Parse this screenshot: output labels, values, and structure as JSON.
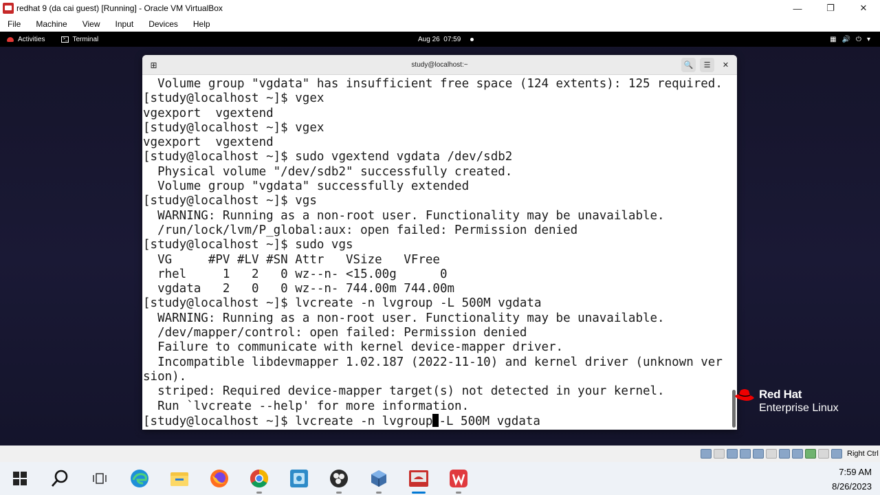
{
  "window": {
    "title": "redhat 9 (da cai guest) [Running] - Oracle VM VirtualBox",
    "controls": [
      "minimize-icon",
      "restore-icon",
      "close-icon"
    ]
  },
  "menubar": {
    "items": [
      "File",
      "Machine",
      "View",
      "Input",
      "Devices",
      "Help"
    ]
  },
  "gnome": {
    "activities": "Activities",
    "app": "Terminal",
    "clock": "Aug 26  07:59",
    "status_icons": [
      "network-icon",
      "volume-icon",
      "power-icon",
      "chevron-down-icon"
    ]
  },
  "terminal": {
    "title": "study@localhost:~",
    "header_buttons": [
      "search-icon",
      "hamburger-menu-icon",
      "close-icon"
    ],
    "lines": [
      "  Volume group \"vgdata\" has insufficient free space (124 extents): 125 required.",
      "[study@localhost ~]$ vgex",
      "vgexport  vgextend",
      "[study@localhost ~]$ vgex",
      "vgexport  vgextend",
      "[study@localhost ~]$ sudo vgextend vgdata /dev/sdb2",
      "  Physical volume \"/dev/sdb2\" successfully created.",
      "  Volume group \"vgdata\" successfully extended",
      "[study@localhost ~]$ vgs",
      "  WARNING: Running as a non-root user. Functionality may be unavailable.",
      "  /run/lock/lvm/P_global:aux: open failed: Permission denied",
      "[study@localhost ~]$ sudo vgs",
      "  VG     #PV #LV #SN Attr   VSize   VFree",
      "  rhel     1   2   0 wz--n- <15.00g      0",
      "  vgdata   2   0   0 wz--n- 744.00m 744.00m",
      "[study@localhost ~]$ lvcreate -n lvgroup -L 500M vgdata",
      "  WARNING: Running as a non-root user. Functionality may be unavailable.",
      "  /dev/mapper/control: open failed: Permission denied",
      "  Failure to communicate with kernel device-mapper driver.",
      "  Incompatible libdevmapper 1.02.187 (2022-11-10) and kernel driver (unknown ver",
      "sion).",
      "  striped: Required device-mapper target(s) not detected in your kernel.",
      "  Run `lvcreate --help' for more information."
    ],
    "current_line": {
      "before_cursor": "[study@localhost ~]$ lvcreate -n lvgroup",
      "after_cursor": "-L 500M vgdata"
    }
  },
  "rhel_logo": {
    "line1": "Red Hat",
    "line2": "Enterprise Linux"
  },
  "statusbar": {
    "host_key": "Right Ctrl"
  },
  "taskbar": {
    "apps": [
      "windows-start-icon",
      "search-icon",
      "task-view-icon",
      "edge-icon",
      "file-explorer-icon",
      "firefox-icon",
      "chrome-icon",
      "photos-icon",
      "obs-icon",
      "virtualbox-icon",
      "virtualbox-vm-icon",
      "wps-icon"
    ],
    "time": "7:59 AM",
    "date": "8/26/2023"
  }
}
